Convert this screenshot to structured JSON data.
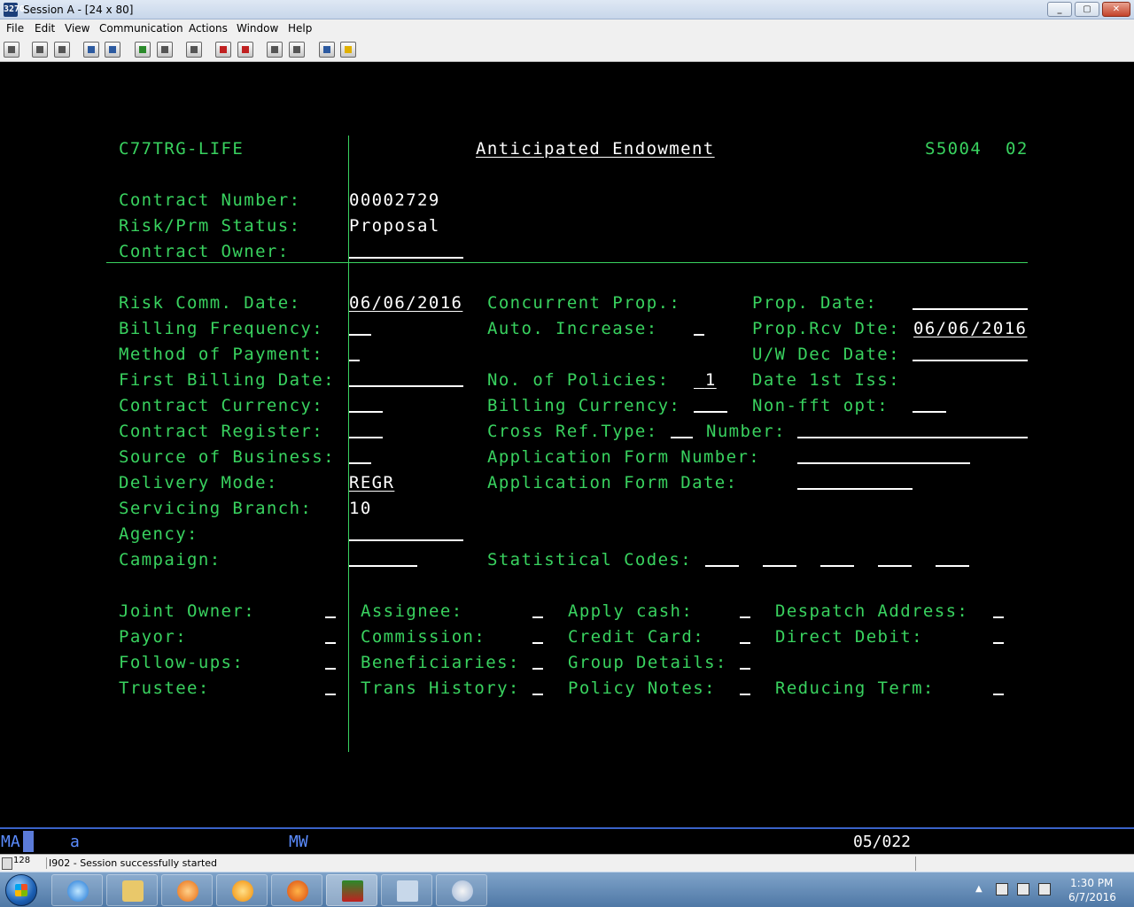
{
  "window": {
    "title": "Session A - [24 x 80]"
  },
  "menu": [
    "File",
    "Edit",
    "View",
    "Communication",
    "Actions",
    "Window",
    "Help"
  ],
  "screen": {
    "system": "C77TRG-LIFE",
    "title": "Anticipated Endowment",
    "screen_id": "S5004",
    "screen_seq": "02",
    "contract_number_label": "Contract Number:",
    "contract_number": "00002729",
    "risk_status_label": "Risk/Prm Status:",
    "risk_status": "Proposal",
    "contract_owner_label": "Contract Owner:",
    "risk_comm_date_label": "Risk Comm. Date:",
    "risk_comm_date": "06/06/2016",
    "billing_frequency_label": "Billing Frequency:",
    "method_of_payment_label": "Method of Payment:",
    "first_billing_date_label": "First Billing Date:",
    "contract_currency_label": "Contract Currency:",
    "contract_register_label": "Contract Register:",
    "source_of_business_label": "Source of Business:",
    "delivery_mode_label": "Delivery Mode:",
    "delivery_mode": "REGR",
    "servicing_branch_label": "Servicing Branch:",
    "servicing_branch": "10",
    "agency_label": "Agency:",
    "campaign_label": "Campaign:",
    "concurrent_prop_label": "Concurrent Prop.:",
    "auto_increase_label": "Auto. Increase:",
    "no_of_policies_label": "No. of Policies:",
    "no_of_policies": "1",
    "billing_currency_label": "Billing Currency:",
    "cross_ref_type_label": "Cross Ref.Type:",
    "number_label": "Number:",
    "application_form_number_label": "Application Form Number:",
    "application_form_date_label": "Application Form Date:",
    "statistical_codes_label": "Statistical Codes:",
    "prop_date_label": "Prop. Date:",
    "prop_rcv_dte_label": "Prop.Rcv Dte:",
    "prop_rcv_dte": "06/06/2016",
    "uw_dec_date_label": "U/W Dec Date:",
    "date_1st_iss_label": "Date 1st Iss:",
    "non_fft_opt_label": "Non-fft opt:",
    "options": {
      "joint_owner": "Joint Owner:",
      "payor": "Payor:",
      "follow_ups": "Follow-ups:",
      "trustee": "Trustee:",
      "assignee": "Assignee:",
      "commission": "Commission:",
      "beneficiaries": "Beneficiaries:",
      "trans_history": "Trans History:",
      "apply_cash": "Apply cash:",
      "credit_card": "Credit Card:",
      "group_details": "Group Details:",
      "policy_notes": "Policy Notes:",
      "despatch_address": "Despatch Address:",
      "direct_debit": "Direct Debit:",
      "reducing_term": "Reducing Term:"
    }
  },
  "oia": {
    "mode": "MA",
    "indicator": "a",
    "mw": "MW",
    "cursor": "05/022"
  },
  "status": {
    "count": "128",
    "message": "I902 - Session successfully started"
  },
  "clock": {
    "time": "1:30 PM",
    "date": "6/7/2016"
  }
}
